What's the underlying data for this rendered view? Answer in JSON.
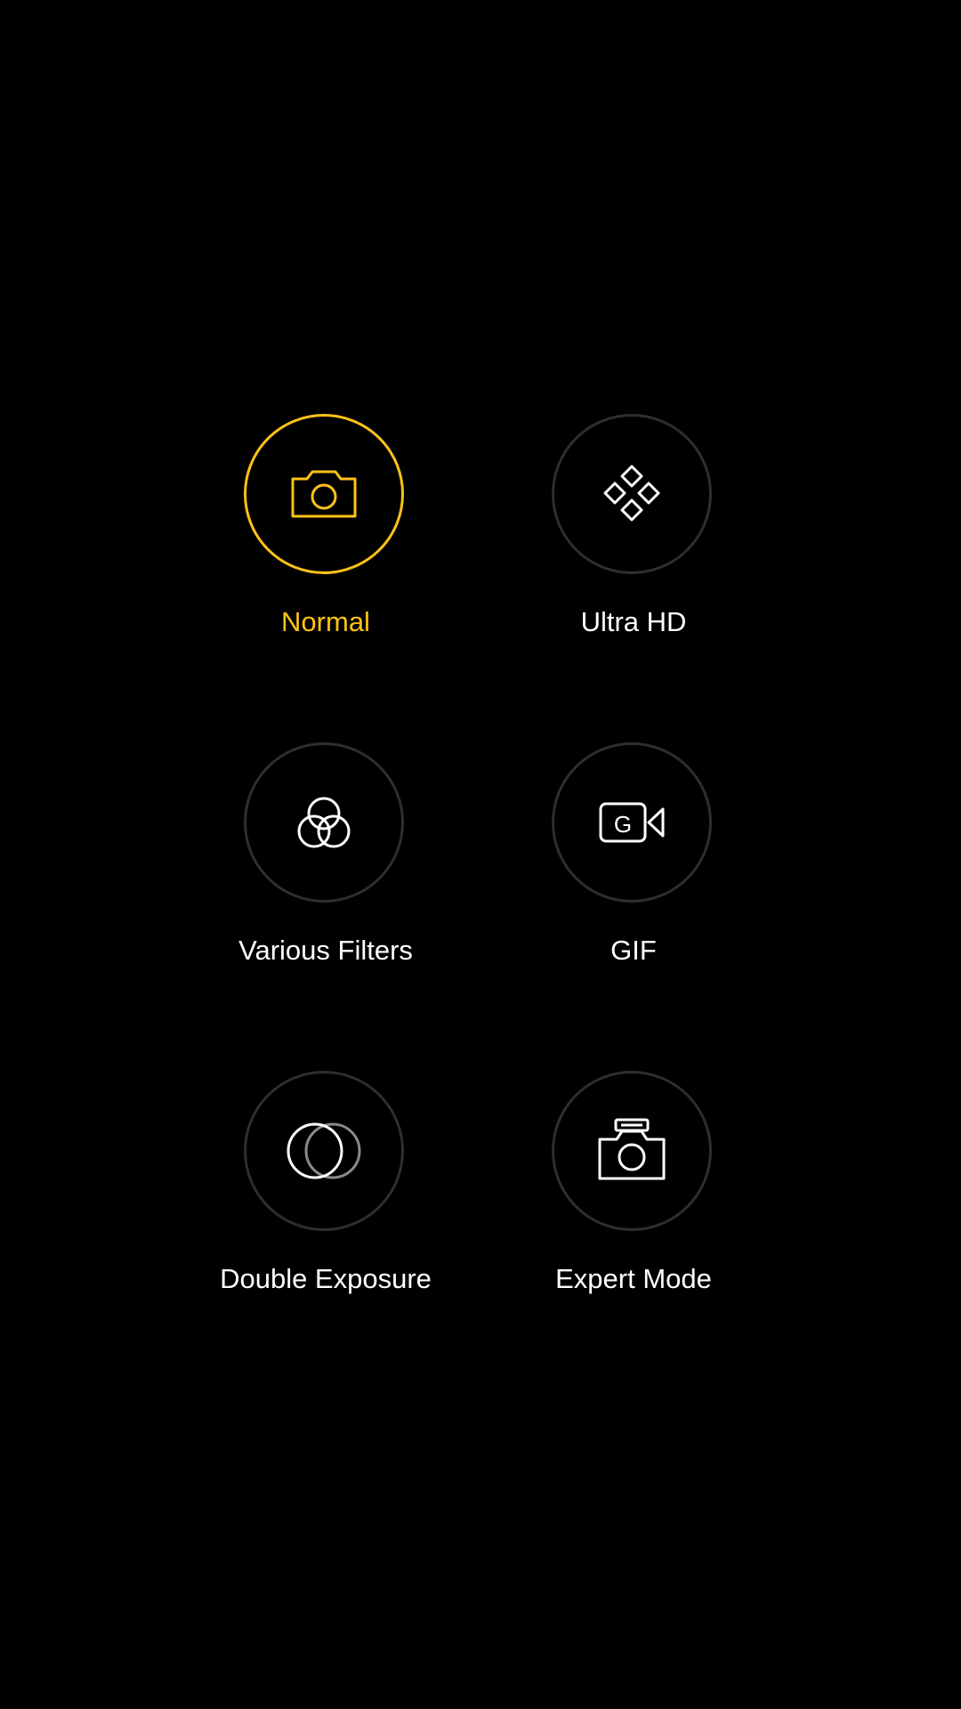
{
  "accent_color": "#ffc21a",
  "modes": [
    {
      "label": "Normal",
      "icon": "camera-icon",
      "selected": true
    },
    {
      "label": "Ultra HD",
      "icon": "diamond-grid-icon",
      "selected": false
    },
    {
      "label": "Various Filters",
      "icon": "filters-icon",
      "selected": false
    },
    {
      "label": "GIF",
      "icon": "gif-video-icon",
      "selected": false
    },
    {
      "label": "Double Exposure",
      "icon": "double-exposure-icon",
      "selected": false
    },
    {
      "label": "Expert Mode",
      "icon": "expert-camera-icon",
      "selected": false
    }
  ]
}
